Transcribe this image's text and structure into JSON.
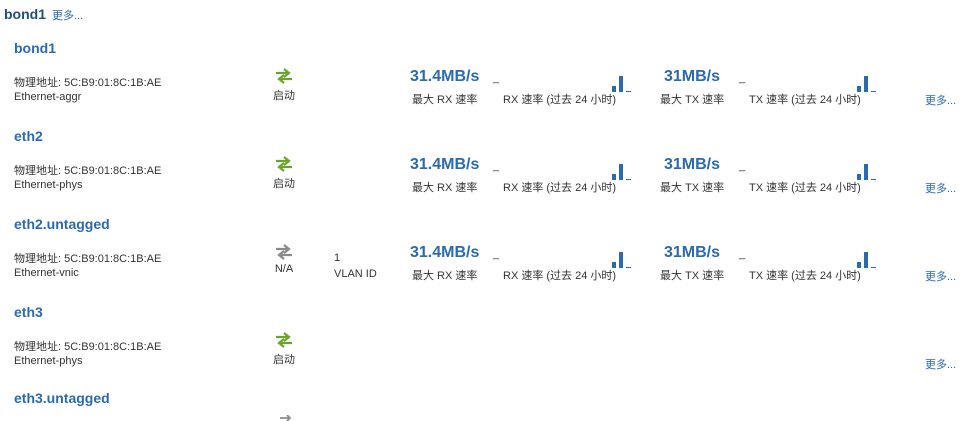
{
  "header": {
    "title": "bond1",
    "more": "更多..."
  },
  "colors": {
    "accent": "#2a6ab1",
    "status_up": "#6aa32a",
    "status_na": "#8a8a8a"
  },
  "interfaces": [
    {
      "name": "bond1",
      "address": "物理地址: 5C:B9:01:8C:1B:AE",
      "type": "Ethernet-aggr",
      "status_icon": "green-arrows-icon",
      "status": "启动",
      "vlan_id": "",
      "vlan_label": "",
      "rx_value": "31.4MB/s",
      "rx_label": "最大 RX 速率",
      "rx_hist_label": "RX 速率 (过去 24 小时)",
      "tx_value": "31MB/s",
      "tx_label": "最大 TX 速率",
      "tx_hist_label": "TX 速率 (过去 24 小时)",
      "more": "更多..."
    },
    {
      "name": "eth2",
      "address": "物理地址: 5C:B9:01:8C:1B:AE",
      "type": "Ethernet-phys",
      "status_icon": "green-arrows-icon",
      "status": "启动",
      "vlan_id": "",
      "vlan_label": "",
      "rx_value": "31.4MB/s",
      "rx_label": "最大 RX 速率",
      "rx_hist_label": "RX 速率 (过去 24 小时)",
      "tx_value": "31MB/s",
      "tx_label": "最大 TX 速率",
      "tx_hist_label": "TX 速率 (过去 24 小时)",
      "more": "更多..."
    },
    {
      "name": "eth2.untagged",
      "address": "物理地址: 5C:B9:01:8C:1B:AE",
      "type": "Ethernet-vnic",
      "status_icon": "gray-arrows-icon",
      "status": "N/A",
      "vlan_id": "1",
      "vlan_label": "VLAN ID",
      "rx_value": "31.4MB/s",
      "rx_label": "最大 RX 速率",
      "rx_hist_label": "RX 速率 (过去 24 小时)",
      "tx_value": "31MB/s",
      "tx_label": "最大 TX 速率",
      "tx_hist_label": "TX 速率 (过去 24 小时)",
      "more": "更多..."
    },
    {
      "name": "eth3",
      "address": "物理地址: 5C:B9:01:8C:1B:AE",
      "type": "Ethernet-phys",
      "status_icon": "green-arrows-icon",
      "status": "启动",
      "vlan_id": "",
      "vlan_label": "",
      "rx_value": "",
      "rx_label": "",
      "rx_hist_label": "",
      "tx_value": "",
      "tx_label": "",
      "tx_hist_label": "",
      "more": "更多..."
    },
    {
      "name": "eth3.untagged"
    }
  ]
}
